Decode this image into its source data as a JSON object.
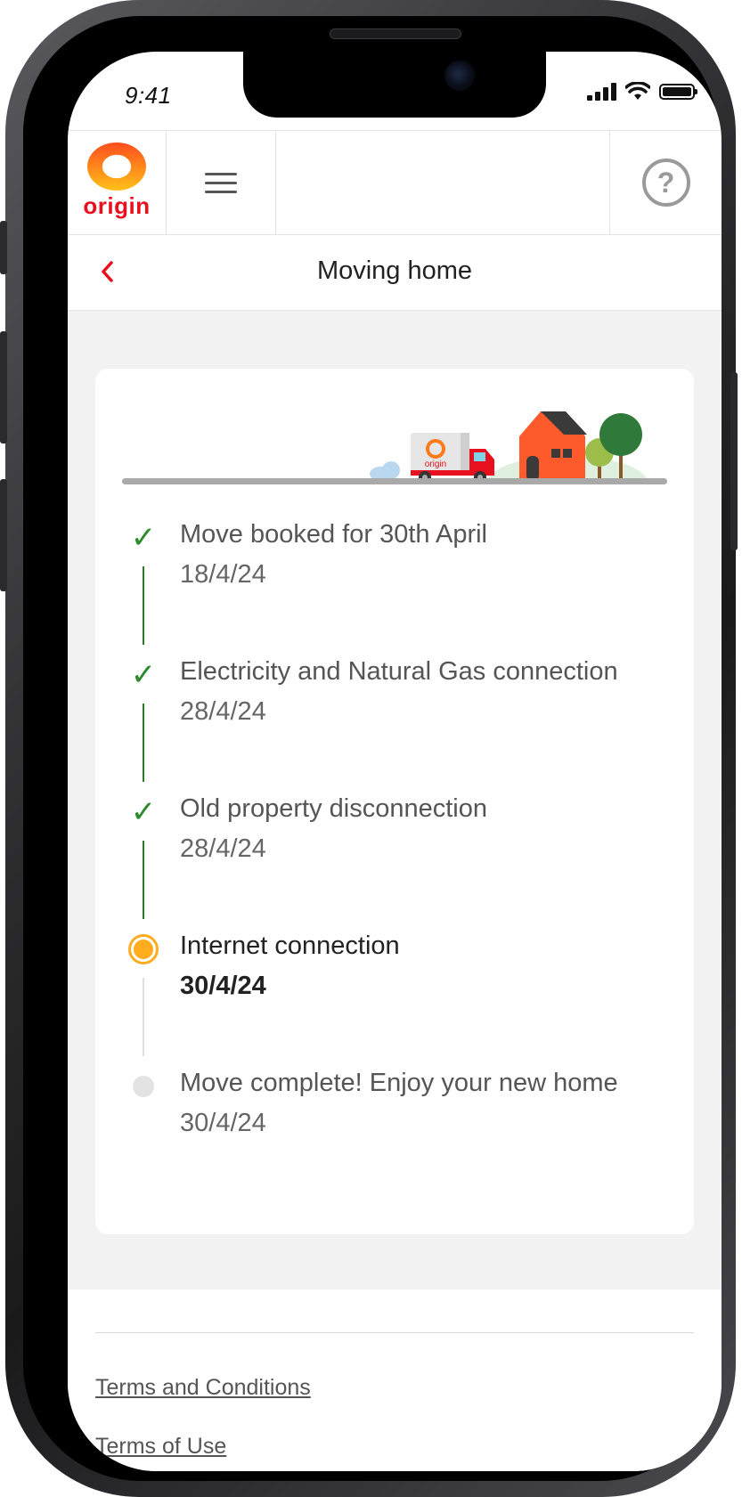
{
  "status_bar": {
    "time": "9:41"
  },
  "header": {
    "logo_text": "origin",
    "menu_icon": "hamburger-icon",
    "help_icon": "help-circle-icon",
    "help_glyph": "?"
  },
  "title_bar": {
    "back_glyph": "‹",
    "title": "Moving home"
  },
  "illustration": {
    "truck_logo_text": "origin"
  },
  "timeline": {
    "steps": [
      {
        "title": "Move booked for 30th April",
        "date": "18/4/24",
        "status": "done"
      },
      {
        "title": "Electricity and Natural Gas connection",
        "date": "28/4/24",
        "status": "done"
      },
      {
        "title": "Old property disconnection",
        "date": "28/4/24",
        "status": "done"
      },
      {
        "title": "Internet connection",
        "date": "30/4/24",
        "status": "active"
      },
      {
        "title": "Move complete! Enjoy your new home",
        "date": "30/4/24",
        "status": "pending"
      }
    ],
    "check_glyph": "✓"
  },
  "footer": {
    "links": [
      "Terms and Conditions",
      "Terms of Use"
    ]
  },
  "colors": {
    "brand_red": "#e8101e",
    "done_green": "#2d8a2d",
    "active_orange": "#ffad1f",
    "pending_gray": "#e3e3e3",
    "page_bg": "#f2f2f2"
  }
}
